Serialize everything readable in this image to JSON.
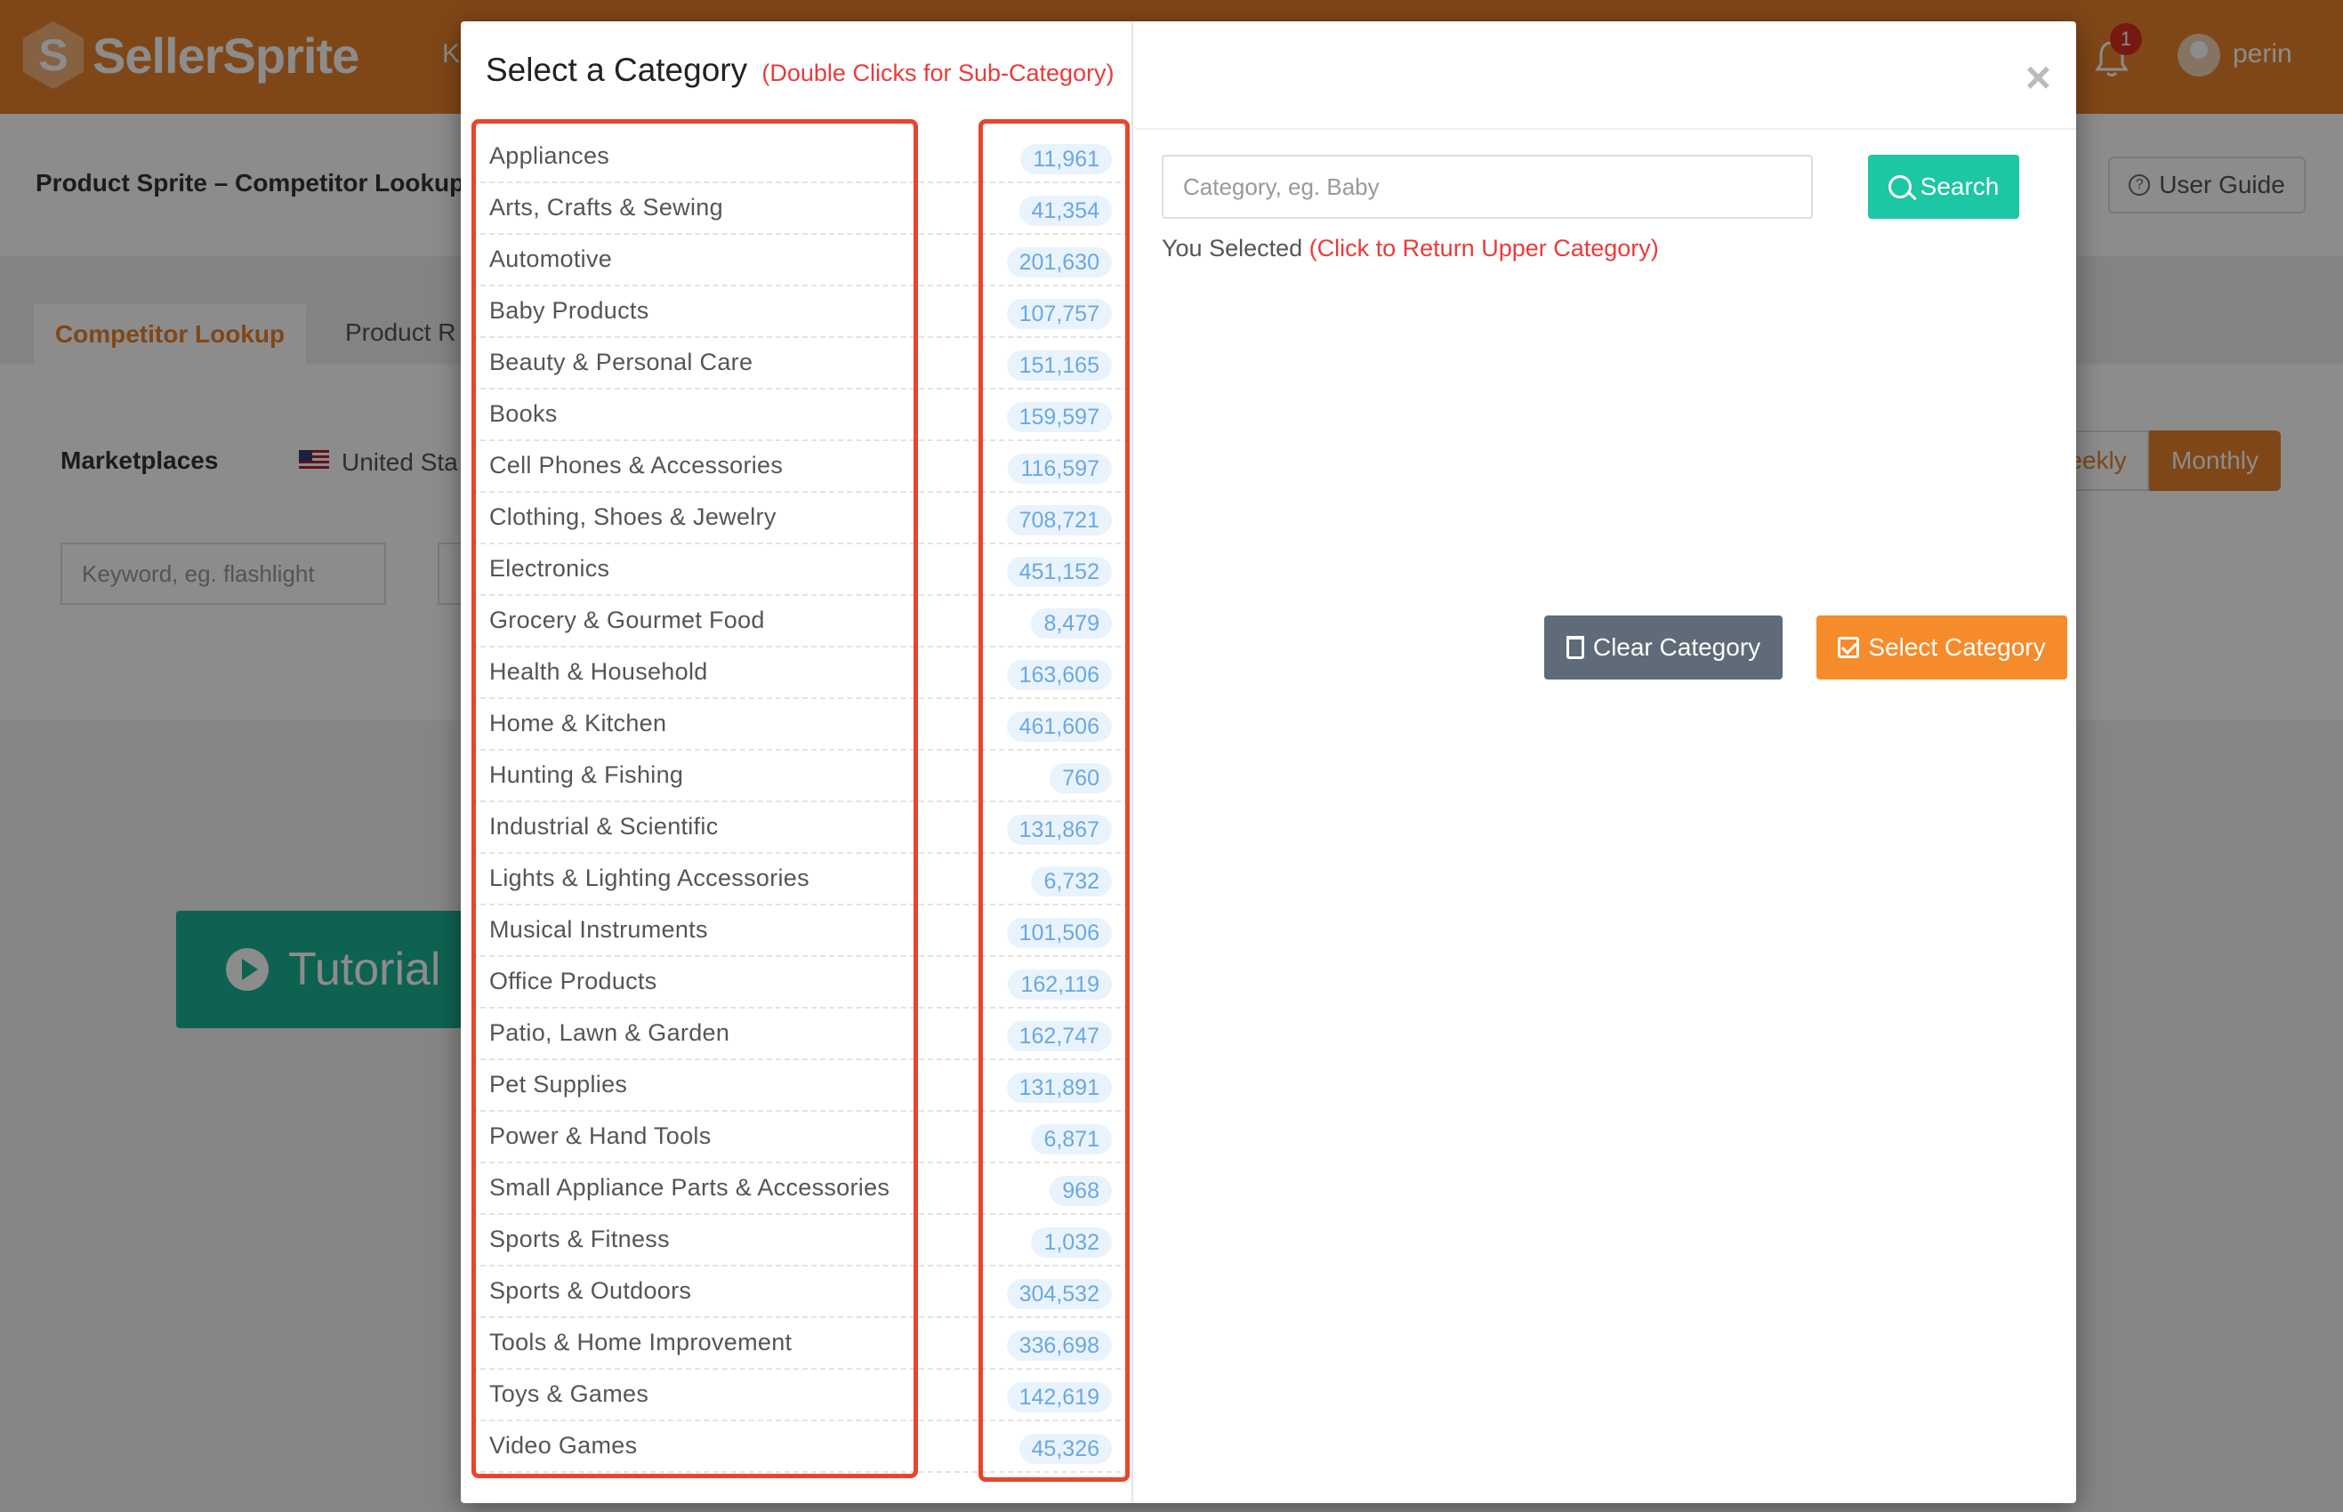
{
  "app": {
    "brand": "SellerSprite",
    "nav_partial": "K",
    "notification_count": "1",
    "username": "perin"
  },
  "page": {
    "title": "Product Sprite – Competitor Lookup",
    "user_guide": "User Guide",
    "tabs": [
      "Competitor Lookup",
      "Product R"
    ],
    "marketplaces_label": "Marketplaces",
    "marketplace_value": "United Sta",
    "period_buttons": [
      "eekly",
      "Monthly"
    ],
    "keyword_placeholder": "Keyword, eg. flashlight",
    "tutorial_label": "Tutorial"
  },
  "modal": {
    "title": "Select a Category",
    "title_hint": "(Double Clicks for Sub-Category)",
    "close": "×",
    "search_placeholder": "Category, eg. Baby",
    "search_button": "Search",
    "you_selected": "You Selected",
    "you_selected_hint": "(Click to Return Upper Category)",
    "clear_button": "Clear Category",
    "select_button": "Select Category",
    "categories": [
      {
        "name": "Appliances",
        "count": "11,961"
      },
      {
        "name": "Arts, Crafts & Sewing",
        "count": "41,354"
      },
      {
        "name": "Automotive",
        "count": "201,630"
      },
      {
        "name": "Baby Products",
        "count": "107,757"
      },
      {
        "name": "Beauty & Personal Care",
        "count": "151,165"
      },
      {
        "name": "Books",
        "count": "159,597"
      },
      {
        "name": "Cell Phones & Accessories",
        "count": "116,597"
      },
      {
        "name": "Clothing, Shoes & Jewelry",
        "count": "708,721"
      },
      {
        "name": "Electronics",
        "count": "451,152"
      },
      {
        "name": "Grocery & Gourmet Food",
        "count": "8,479"
      },
      {
        "name": "Health & Household",
        "count": "163,606"
      },
      {
        "name": "Home & Kitchen",
        "count": "461,606"
      },
      {
        "name": "Hunting & Fishing",
        "count": "760"
      },
      {
        "name": "Industrial & Scientific",
        "count": "131,867"
      },
      {
        "name": "Lights & Lighting Accessories",
        "count": "6,732"
      },
      {
        "name": "Musical Instruments",
        "count": "101,506"
      },
      {
        "name": "Office Products",
        "count": "162,119"
      },
      {
        "name": "Patio, Lawn & Garden",
        "count": "162,747"
      },
      {
        "name": "Pet Supplies",
        "count": "131,891"
      },
      {
        "name": "Power & Hand Tools",
        "count": "6,871"
      },
      {
        "name": "Small Appliance Parts & Accessories",
        "count": "968"
      },
      {
        "name": "Sports & Fitness",
        "count": "1,032"
      },
      {
        "name": "Sports & Outdoors",
        "count": "304,532"
      },
      {
        "name": "Tools & Home Improvement",
        "count": "336,698"
      },
      {
        "name": "Toys & Games",
        "count": "142,619"
      },
      {
        "name": "Video Games",
        "count": "45,326"
      }
    ]
  },
  "colors": {
    "brand_orange": "#e8822a",
    "teal": "#1cc7a3",
    "hint_red": "#e93b3b",
    "highlight_box": "#e8452c"
  }
}
